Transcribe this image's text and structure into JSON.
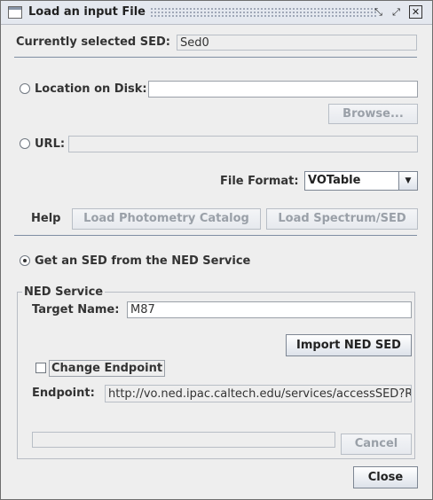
{
  "window": {
    "title": "Load an input File",
    "controls": [
      "minimize-icon",
      "maximize-icon",
      "close-icon"
    ]
  },
  "sed": {
    "label": "Currently selected SED:",
    "value": "Sed0"
  },
  "disk": {
    "label": "Location on Disk:",
    "value": "",
    "browse": "Browse..."
  },
  "url": {
    "label": "URL:",
    "value": ""
  },
  "format": {
    "label": "File Format:",
    "selected": "VOTable"
  },
  "help": {
    "label": "Help",
    "photometry": "Load Photometry Catalog",
    "spectrum": "Load Spectrum/SED"
  },
  "ned": {
    "option_label": "Get an SED from the NED Service",
    "group_title": "NED Service",
    "target_label": "Target Name:",
    "target_value": "M87",
    "import_button": "Import NED SED",
    "change_endpoint": "Change Endpoint",
    "endpoint_label": "Endpoint:",
    "endpoint_value": "http://vo.ned.ipac.caltech.edu/services/accessSED?REQUEST=queryData&TARGETNAME=",
    "cancel_button": "Cancel",
    "progress": 0
  },
  "footer": {
    "close_button": "Close"
  }
}
